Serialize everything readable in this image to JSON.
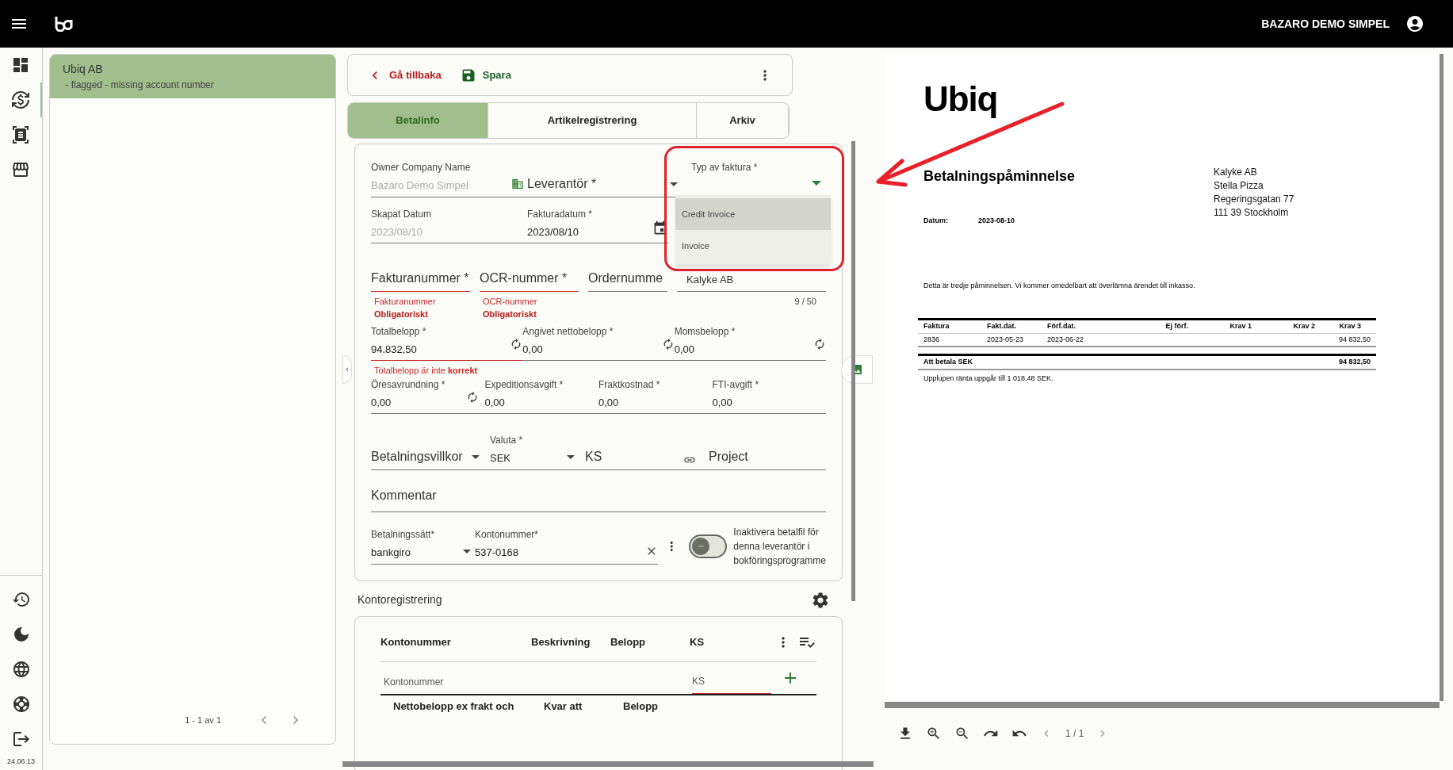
{
  "topbar": {
    "account": "BAZARO DEMO SIMPEL"
  },
  "rail": {
    "items": [
      {
        "selected": false
      },
      {
        "selected": true
      },
      {
        "selected": false
      },
      {
        "selected": false
      }
    ],
    "version": "24.06.13"
  },
  "list": {
    "items": [
      {
        "title": "Ubiq AB",
        "subtitle": " - flagged - missing account number",
        "selected": true
      }
    ],
    "pagination": "1 - 1 av 1"
  },
  "toolbar": {
    "back": "Gå tillbaka",
    "save": "Spara"
  },
  "tabs": [
    {
      "label": "Betalinfo",
      "selected": true
    },
    {
      "label": "Artikelregistrering",
      "selected": false
    },
    {
      "label": "Arkiv",
      "selected": false
    }
  ],
  "form": {
    "owner": {
      "label": "Owner Company Name",
      "value": "Bazaro Demo Simpel",
      "disabled": true
    },
    "supplier": {
      "label": "Leverantör *"
    },
    "invoice_type": {
      "label": "Typ av faktura *",
      "options": [
        {
          "label": "Credit Invoice",
          "selected": true
        },
        {
          "label": "Invoice",
          "selected": false
        }
      ]
    },
    "created": {
      "label": "Skapat Datum",
      "value": "2023/08/10",
      "disabled": true
    },
    "invoice_date": {
      "label": "Fakturadatum *",
      "value": "2023/08/10"
    },
    "numbers": [
      {
        "label": "Fakturanummer *",
        "error": "Fakturanummer",
        "error_detail": "Obligatoriskt"
      },
      {
        "label": "OCR-nummer *",
        "error": "OCR-nummer",
        "error_detail": "Obligatoriskt"
      },
      {
        "label": "Ordernumme"
      }
    ],
    "reference": {
      "value": "Kalyke AB",
      "counter": "9 / 50"
    },
    "amounts": [
      {
        "label": "Totalbelopp *",
        "value": "94.832,50",
        "error": true
      },
      {
        "label": "Angivet nettobelopp *",
        "value": "0,00",
        "error": false
      },
      {
        "label": "Momsbelopp *",
        "value": "0,00",
        "error": false
      }
    ],
    "amount_error": "Totalbelopp är inte **korrekt**",
    "fees": [
      {
        "label": "Öresavrundning *",
        "value": "0,00",
        "refresh": true
      },
      {
        "label": "Expeditionsavgift *",
        "value": "0,00",
        "refresh": false
      },
      {
        "label": "Fraktkostnad *",
        "value": "0,00",
        "refresh": false
      },
      {
        "label": "FTI-avgift *",
        "value": "0,00",
        "refresh": false
      }
    ],
    "terms": {
      "label": "Betalningsvillkor"
    },
    "currency": {
      "label": "Valuta *",
      "value": "SEK"
    },
    "ks": {
      "label": "KS"
    },
    "project": {
      "label": "Project"
    },
    "comment": {
      "label": "Kommentar"
    },
    "payment_method": {
      "label": "Betalningssätt*",
      "value": "bankgiro"
    },
    "account": {
      "label": "Kontonummer*",
      "value": "537-0168"
    },
    "disable_file": {
      "label": "Inaktivera betalfil för denna leverantör i bokföringsprogramme",
      "on": false
    }
  },
  "accounting": {
    "title": "Kontoregistrering",
    "columns": [
      "Kontonummer",
      "Beskrivning",
      "Belopp",
      "KS"
    ],
    "account_placeholder": "Kontonummer",
    "ks_placeholder": "KS",
    "summary_columns": [
      "Nettobelopp ex frakt och",
      "Kvar att",
      "Belopp"
    ]
  },
  "preview": {
    "logo": "Ubiq",
    "title": "Betalningspåminnelse",
    "date_label": "Datum:",
    "date": "2023-08-10",
    "address": [
      "Kalyke AB",
      "Stella Pizza",
      "Regeringsgatan 77",
      "111 39 Stockholm"
    ],
    "message": "Detta är tredje påminnelsen. Vi kommer omedelbart att överlämna ärendet till inkasso.",
    "columns": [
      "Faktura",
      "Fakt.dat.",
      "Förf.dat.",
      "Ej förf.",
      "Krav 1",
      "Krav 2",
      "Krav 3"
    ],
    "rows": [
      [
        "2836",
        "2023-05-23",
        "2023-06-22",
        "",
        "",
        "",
        "94 832,50"
      ]
    ],
    "total_label": "Att betala SEK",
    "total": "94 832,50",
    "interest": "Upplupen ränta uppgår till 1 018,48 SEK.",
    "pager": "1 / 1"
  }
}
